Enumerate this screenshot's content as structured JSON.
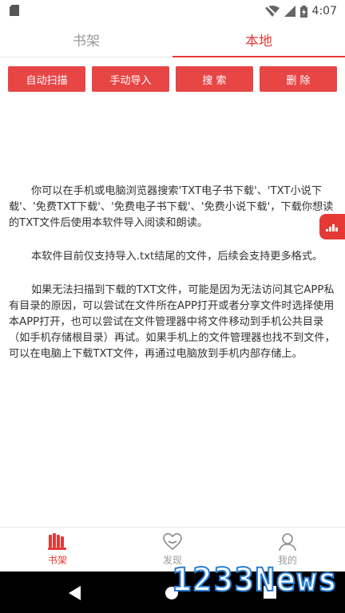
{
  "status_bar": {
    "time": "4:07"
  },
  "tabs": [
    {
      "label": "书架",
      "active": false
    },
    {
      "label": "本地",
      "active": true
    }
  ],
  "actions": {
    "auto_scan": "自动扫描",
    "manual_import": "手动导入",
    "search": "搜 索",
    "delete": "删 除"
  },
  "content": {
    "p1": "你可以在手机或电脑浏览器搜索'TXT电子书下载'、'TXT小说下载'、'免费TXT下载'、'免费电子书下载'、'免费小说下载'，下载你想读的TXT文件后使用本软件导入阅读和朗读。",
    "p2": "本软件目前仅支持导入.txt结尾的文件，后续会支持更多格式。",
    "p3": "如果无法扫描到下载的TXT文件，可能是因为无法访问其它APP私有目录的原因，可以尝试在文件所在APP打开或者分享文件时选择使用本APP打开，也可以尝试在文件管理器中将文件移动到手机公共目录（如手机存储根目录）再试。如果手机上的文件管理器也找不到文件，可以在电脑上下载TXT文件，再通过电脑放到手机内部存储上。"
  },
  "bottom_nav": [
    {
      "label": "书架",
      "icon": "bookshelf-icon",
      "active": true
    },
    {
      "label": "发现",
      "icon": "discover-icon",
      "active": false
    },
    {
      "label": "我的",
      "icon": "profile-icon",
      "active": false
    }
  ],
  "watermark": "1233News",
  "colors": {
    "accent": "#e53935",
    "button": "#e84545",
    "inactive": "#9a9a9a"
  }
}
